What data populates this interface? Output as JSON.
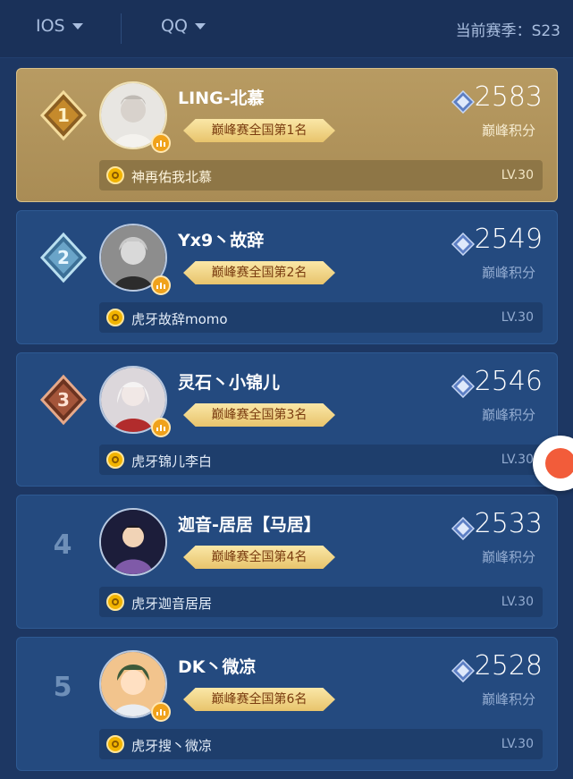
{
  "header": {
    "platform": "IOS",
    "account": "QQ",
    "season_label": "当前赛季：",
    "season_value": "S23"
  },
  "colors": {
    "background": "#1d3763",
    "card": "#244a7f",
    "gold_card": "#b89b62",
    "ribbon": "#f3d58a",
    "ribbon_text": "#7a3c10"
  },
  "players": [
    {
      "rank": "1",
      "name": "LING-北慕",
      "badge": "巅峰赛全国第1名",
      "score": "2583",
      "score_label": "巅峰积分",
      "stream": "神再佑我北慕",
      "level": "LV.30"
    },
    {
      "rank": "2",
      "name": "Yx9丶故辞",
      "badge": "巅峰赛全国第2名",
      "score": "2549",
      "score_label": "巅峰积分",
      "stream": "虎牙故辞momo",
      "level": "LV.30"
    },
    {
      "rank": "3",
      "name": "灵石丶小锦儿",
      "badge": "巅峰赛全国第3名",
      "score": "2546",
      "score_label": "巅峰积分",
      "stream": "虎牙锦儿李白",
      "level": "LV.30"
    },
    {
      "rank": "4",
      "name": "迦音-居居【马居】",
      "badge": "巅峰赛全国第4名",
      "score": "2533",
      "score_label": "巅峰积分",
      "stream": "虎牙迦音居居",
      "level": "LV.30"
    },
    {
      "rank": "5",
      "name": "DK丶微凉",
      "badge": "巅峰赛全国第6名",
      "score": "2528",
      "score_label": "巅峰积分",
      "stream": "虎牙搜丶微凉",
      "level": "LV.30"
    }
  ]
}
